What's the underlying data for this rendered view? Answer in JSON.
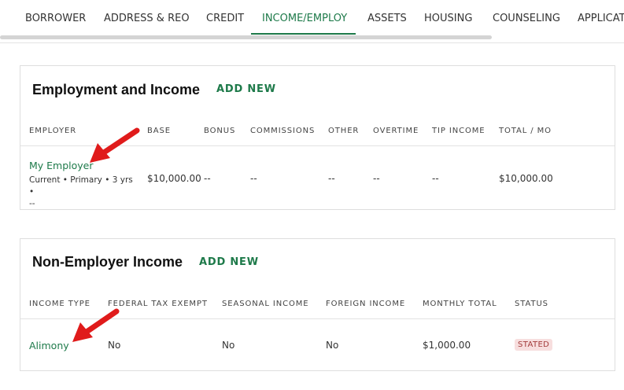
{
  "tabs": [
    {
      "label": "BORROWER",
      "active": false
    },
    {
      "label": "ADDRESS & REO",
      "active": false
    },
    {
      "label": "CREDIT",
      "active": false
    },
    {
      "label": "INCOME/EMPLOY",
      "active": true
    },
    {
      "label": "ASSETS",
      "active": false
    },
    {
      "label": "HOUSING",
      "active": false
    },
    {
      "label": "COUNSELING",
      "active": false
    },
    {
      "label": "APPLICAT",
      "active": false
    }
  ],
  "employment": {
    "title": "Employment and Income",
    "add_new": "ADD NEW",
    "columns": [
      "EMPLOYER",
      "BASE",
      "BONUS",
      "COMMISSIONS",
      "OTHER",
      "OVERTIME",
      "TIP INCOME",
      "TOTAL / MO"
    ],
    "rows": [
      {
        "employer": "My Employer",
        "details_line1": "Current • Primary • 3 yrs •",
        "details_line2": "--",
        "base": "$10,000.00",
        "bonus": "--",
        "commissions": "--",
        "other": "--",
        "overtime": "--",
        "tip_income": "--",
        "total": "$10,000.00"
      }
    ]
  },
  "non_employer": {
    "title": "Non-Employer Income",
    "add_new": "ADD NEW",
    "columns": [
      "INCOME TYPE",
      "FEDERAL TAX EXEMPT",
      "SEASONAL INCOME",
      "FOREIGN INCOME",
      "MONTHLY TOTAL",
      "STATUS"
    ],
    "rows": [
      {
        "income_type": "Alimony",
        "federal_tax_exempt": "No",
        "seasonal_income": "No",
        "foreign_income": "No",
        "monthly_total": "$1,000.00",
        "status": "STATED"
      }
    ]
  },
  "colors": {
    "accent": "#1e7a4a",
    "arrow": "#e01b1b",
    "badge_bg": "#f7dede",
    "badge_text": "#a33b3b"
  },
  "icons": [
    "red-arrow-annotation"
  ]
}
